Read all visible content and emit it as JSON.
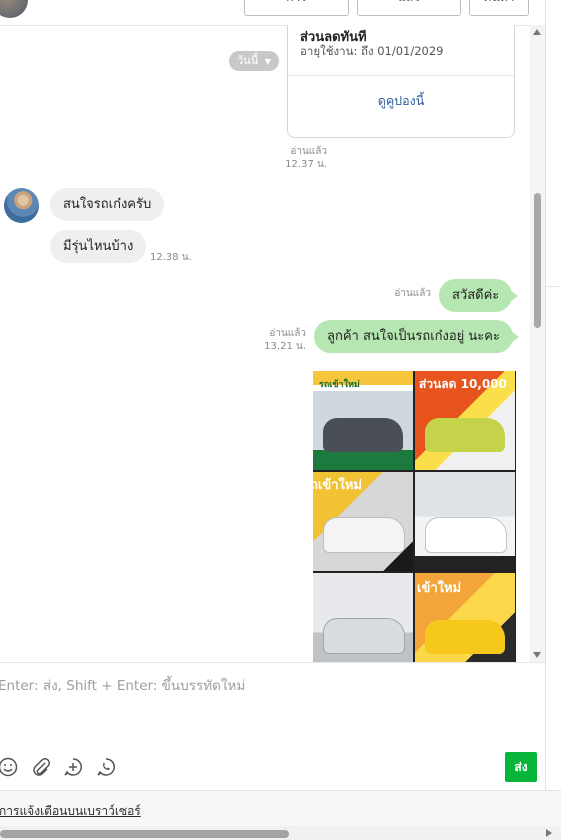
{
  "header": {
    "buttons": [
      "การ",
      "แล้ว",
      "ค้นหา"
    ]
  },
  "chat": {
    "date_chip": "วันนี้",
    "coupon": {
      "title": "ส่วนลดทันที",
      "expiry": "อายุใช้งาน: ถึง 01/01/2029",
      "link": "ดูคูปองนี้"
    },
    "coupon_meta": {
      "read": "อ่านแล้ว",
      "time": "12.37 น."
    },
    "messages_in": [
      {
        "text": "สนใจรถเก๋งครับ"
      },
      {
        "text": "มีรุ่นไหนบ้าง",
        "time": "12.38 น."
      }
    ],
    "messages_out": [
      {
        "text": "สวัสดีค่ะ",
        "read": "อ่านแล้ว"
      },
      {
        "text": "ลูกค้า สนใจเป็นรถเก๋งอยู่ นะคะ",
        "read": "อ่านแล้ว",
        "time": "13.21 น."
      }
    ],
    "image_badges": [
      "รถเข้าใหม่",
      "ส่วนลด 10,000",
      "ถเข้าใหม่",
      "เข้าใหม่"
    ]
  },
  "composer": {
    "placeholder": "Enter: ส่ง, Shift + Enter: ขึ้นบรรทัดใหม่",
    "tools": [
      "emoji-icon",
      "attach-icon",
      "add-icon",
      "phone-icon"
    ],
    "send_label": "ส่ง"
  },
  "notice": {
    "link": "การแจ้งเตือนบนเบราว์เซอร์"
  },
  "colors": {
    "send": "#07b53b",
    "bubble_out": "#b6e6b1",
    "bubble_in": "#efefef",
    "link": "#2e5b9b"
  }
}
